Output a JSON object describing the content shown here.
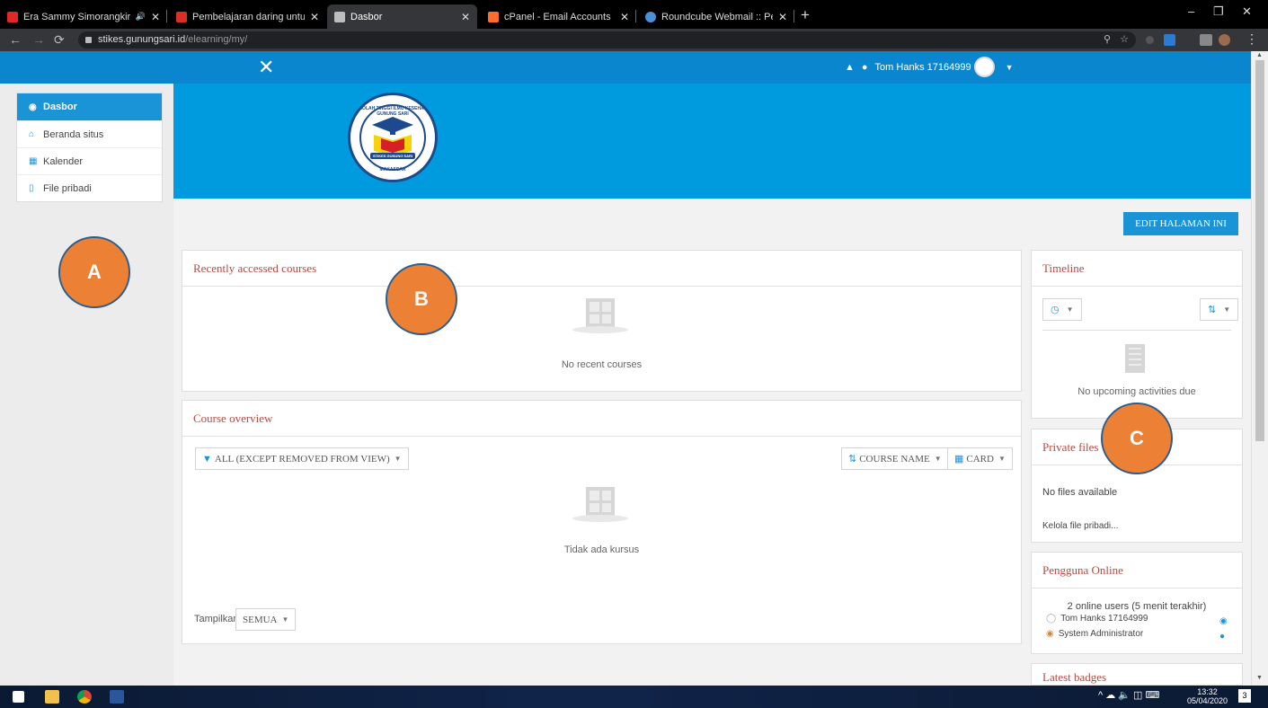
{
  "browser": {
    "tabs": [
      {
        "title": "Era Sammy Simorangkir Top",
        "favicon_color": "#e02828",
        "extra": "🔊"
      },
      {
        "title": "Pembelajaran daring untuk Dose",
        "favicon_color": "#d93025"
      },
      {
        "title": "Dasbor",
        "favicon_color": "#bdbdbd"
      },
      {
        "title": "cPanel - Email Accounts",
        "favicon_color": "#ff6c2c"
      },
      {
        "title": "Roundcube Webmail :: Pembelaja",
        "favicon_color": "#4a90d9"
      }
    ],
    "url_host": "stikes.gunungsari.id",
    "url_path": "/elearning/my/",
    "new_tab": "+",
    "window_controls": [
      "–",
      "❐",
      "✕"
    ]
  },
  "navbar": {
    "close_icon": "✕",
    "bell_icon": "🔔",
    "chat_icon": "●",
    "user_name": "Tom Hanks 17164999",
    "caret": "▼",
    "color": "#0a86cf"
  },
  "drawer": {
    "items": [
      {
        "label": "Dasbor",
        "icon": "dashboard-icon",
        "glyph": "◉",
        "active": true
      },
      {
        "label": "Beranda situs",
        "icon": "home-icon",
        "glyph": "⌂",
        "active": false
      },
      {
        "label": "Kalender",
        "icon": "calendar-icon",
        "glyph": "▦",
        "active": false
      },
      {
        "label": "File pribadi",
        "icon": "file-icon",
        "glyph": "▯",
        "active": false
      }
    ]
  },
  "logo": {
    "top_text": "SEKOLAH TINGGI ILMU KESEHATAN GUNUNG SARI",
    "banner_text": "STIKES GUNUNG SARI",
    "bottom_text": "MAKASSAR"
  },
  "page": {
    "edit_button": "EDIT HALAMAN INI"
  },
  "recent_courses": {
    "title": "Recently accessed courses",
    "empty": "No recent courses"
  },
  "course_overview": {
    "title": "Course overview",
    "filter": "ALL (EXCEPT REMOVED FROM VIEW)",
    "sort": "COURSE NAME",
    "view": "CARD",
    "empty": "Tidak ada kursus",
    "show_label": "Tampilkan",
    "show_value": "SEMUA"
  },
  "timeline": {
    "title": "Timeline",
    "empty": "No upcoming activities due"
  },
  "private_files": {
    "title": "Private files",
    "empty": "No files available",
    "manage_link": "Kelola file pribadi..."
  },
  "online_users": {
    "title": "Pengguna Online",
    "summary": "2 online users (5 menit terakhir)",
    "users": [
      "Tom Hanks 17164999",
      "System Administrator"
    ]
  },
  "latest_badges": {
    "title": "Latest badges"
  },
  "markers": [
    "A",
    "B",
    "C"
  ],
  "taskbar": {
    "time": "13:32",
    "date": "05/04/2020",
    "tray_icons": "^ ☁ 🔈 ◫ ⌨",
    "notification_count": "3"
  }
}
